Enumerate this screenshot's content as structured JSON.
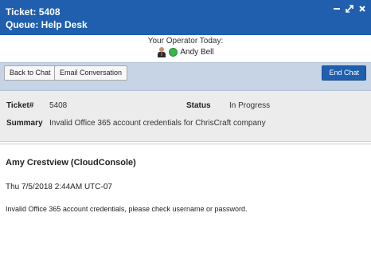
{
  "header": {
    "ticket_line": "Ticket: 5408",
    "queue_line": "Queue: Help Desk",
    "controls": [
      "minimize-icon",
      "expand-icon",
      "close-icon"
    ]
  },
  "operator": {
    "caption": "Your Operator Today:",
    "name": "Andy Bell",
    "status_color": "#3bb54a"
  },
  "toolbar": {
    "back_label": "Back to Chat",
    "email_label": "Email Conversation",
    "end_label": "End Chat"
  },
  "ticket_info": {
    "ticket_label": "Ticket#",
    "ticket_value": "5408",
    "status_label": "Status",
    "status_value": "In Progress",
    "summary_label": "Summary",
    "summary_value": "Invalid Office 365 account credentials for ChrisCraft company"
  },
  "message": {
    "sender": "Amy Crestview (CloudConsole)",
    "timestamp": "Thu 7/5/2018 2:44AM UTC-07",
    "body": "Invalid Office 365 account credentials, please check username or password."
  },
  "colors": {
    "header_bg": "#1f5fad",
    "toolbar_bg": "#c6d4e6",
    "info_bg": "#ececec",
    "accent_button": "#1f5fad"
  }
}
